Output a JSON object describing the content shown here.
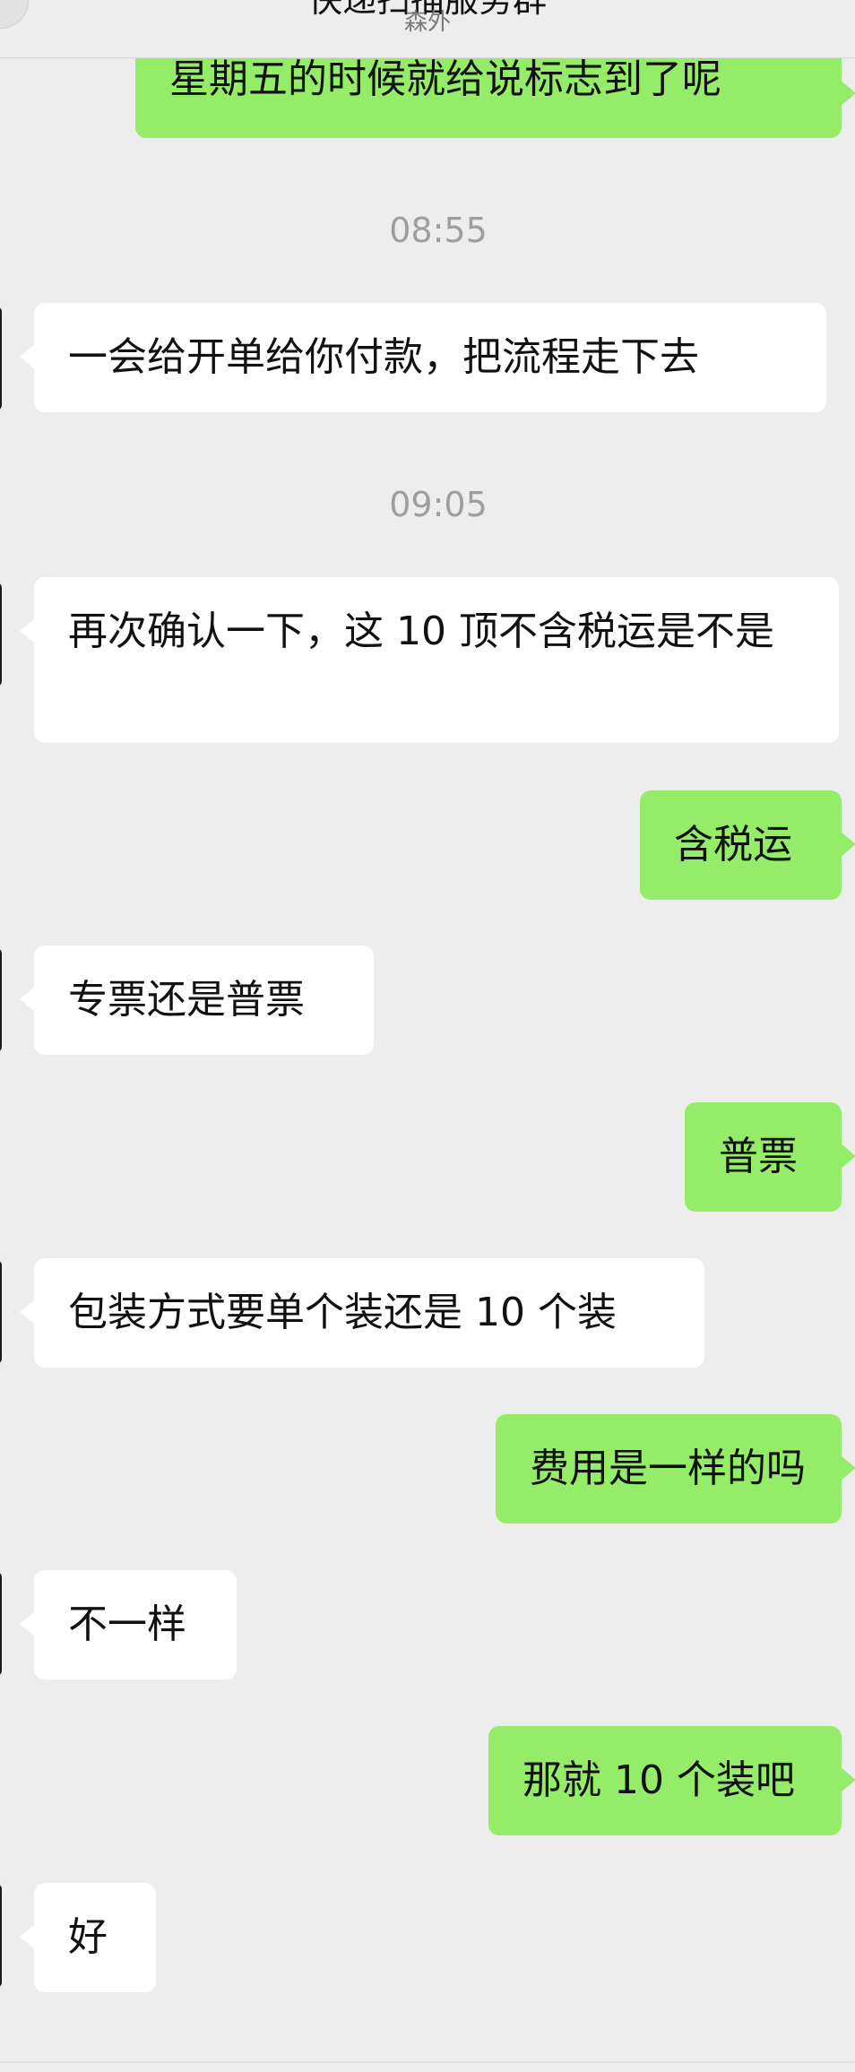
{
  "header": {
    "title": "快递扫描服务群",
    "subtitle": "森外"
  },
  "messages": [
    {
      "side": "out",
      "text": "星期五的时候就给说标志到了呢"
    },
    {
      "type": "time",
      "text": "08:55"
    },
    {
      "side": "in",
      "text": "一会给开单给你付款，把流程走下去"
    },
    {
      "type": "time",
      "text": "09:05"
    },
    {
      "side": "in",
      "text": "再次确认一下，这 10 顶不含税运是不是"
    },
    {
      "side": "out",
      "text": "含税运"
    },
    {
      "side": "in",
      "text": "专票还是普票"
    },
    {
      "side": "out",
      "text": "普票"
    },
    {
      "side": "in",
      "text": "包装方式要单个装还是 10 个装"
    },
    {
      "side": "out",
      "text": "费用是一样的吗"
    },
    {
      "side": "in",
      "text": "不一样"
    },
    {
      "side": "out",
      "text": "那就 10 个装吧"
    },
    {
      "side": "in",
      "text": "好"
    }
  ]
}
